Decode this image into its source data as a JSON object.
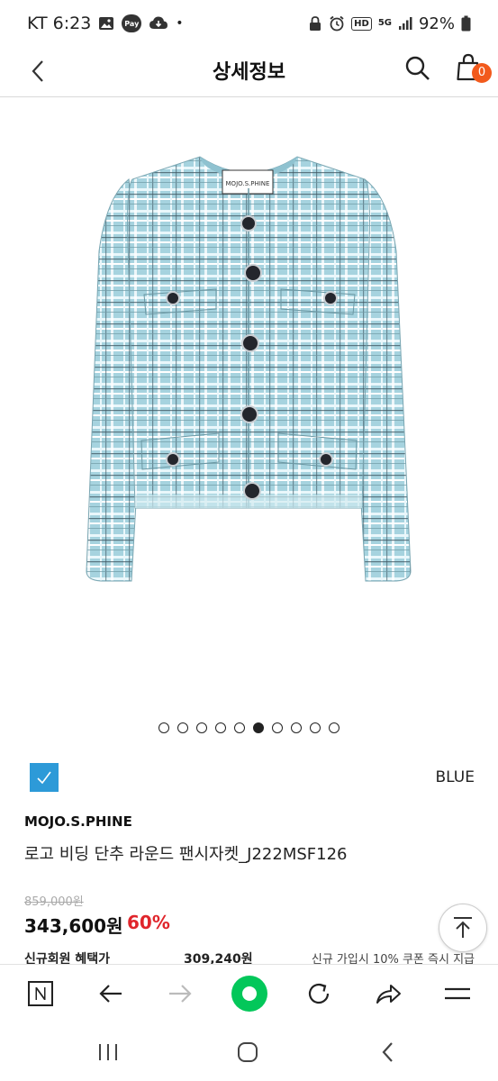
{
  "status_bar": {
    "carrier_time": "KT 6:23",
    "pay_label": "Pay",
    "hd_label": "HD",
    "network": "5G",
    "battery": "92%"
  },
  "header": {
    "title": "상세정보",
    "cart_count": "0"
  },
  "product_image": {
    "label_text": "MOJO.S.PHINE",
    "accent_color": "#9ccbd8"
  },
  "carousel": {
    "total": 10,
    "active_index": 5
  },
  "color_option": {
    "name": "BLUE",
    "swatch_color": "#2d9ad8"
  },
  "product": {
    "brand": "MOJO.S.PHINE",
    "name": "로고 비딩 단추 라운드 팬시자켓_J222MSF126",
    "original_price": "859,000원",
    "sale_price": "343,600원",
    "discount": "60%"
  },
  "member_benefit": {
    "label": "신규회원 혜택가",
    "price": "309,240원",
    "note": "신규 가입시 10% 쿠폰 즉시 지급"
  },
  "colors": {
    "discount_red": "#e0252b",
    "cart_badge": "#f25a1c",
    "naver_green": "#03c75a"
  }
}
